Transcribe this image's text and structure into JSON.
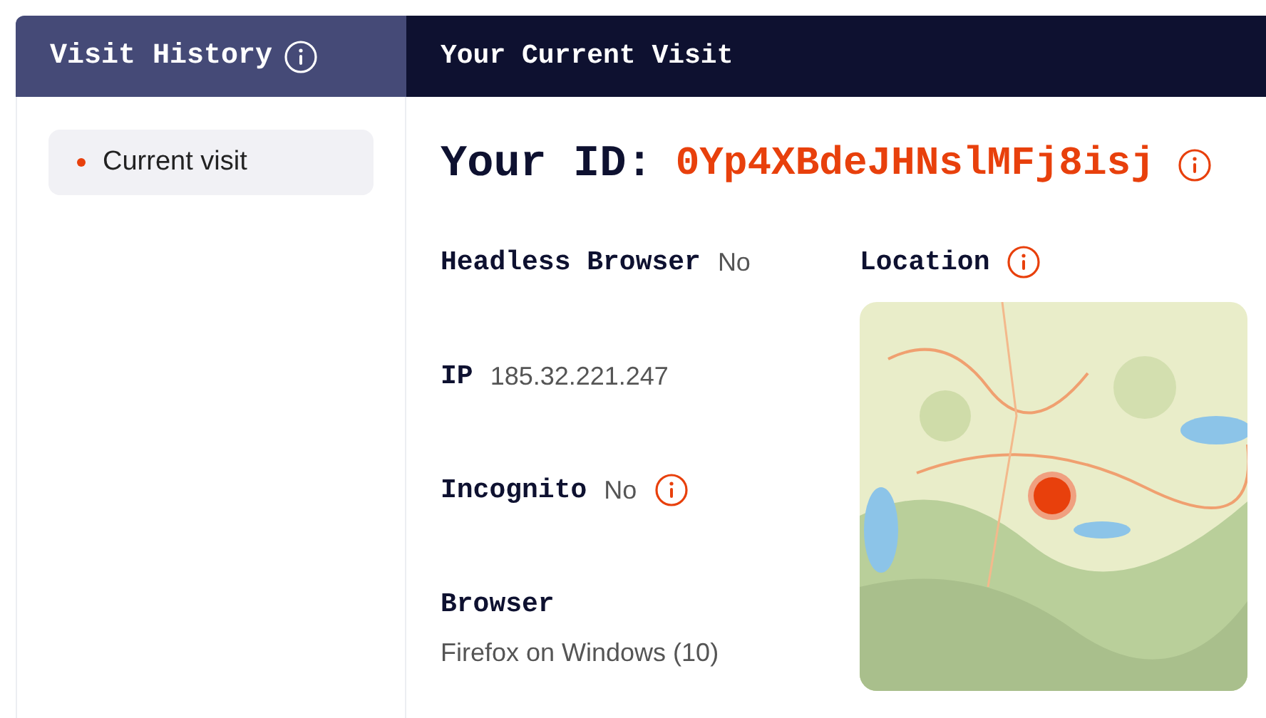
{
  "sidebar": {
    "title": "Visit History",
    "items": [
      {
        "label": "Current visit",
        "selected": true
      }
    ]
  },
  "main": {
    "title": "Your Current Visit",
    "id_label": "Your ID:",
    "id_value": "0Yp4XBdeJHNslMFj8isj",
    "fields": [
      {
        "kind": "inline",
        "label": "Headless Browser",
        "value": "No",
        "info": false
      },
      {
        "kind": "inline",
        "label": "IP",
        "value": "185.32.221.247",
        "info": false
      },
      {
        "kind": "inline",
        "label": "Incognito",
        "value": "No",
        "info": true
      },
      {
        "kind": "stacked",
        "label": "Browser",
        "value": "Firefox on Windows (10)",
        "info": false
      }
    ],
    "location": {
      "label": "Location"
    }
  }
}
